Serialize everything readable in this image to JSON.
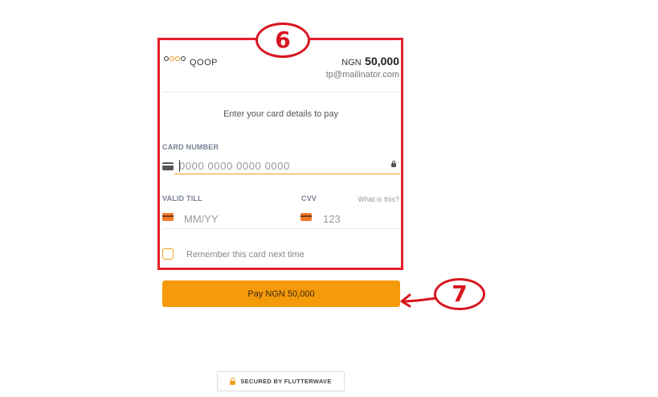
{
  "merchant": {
    "name": "QOOP"
  },
  "payment": {
    "currency": "NGN",
    "amount": "50,000",
    "email": "tp@mailinator.com"
  },
  "form": {
    "instruction": "Enter your card details to pay",
    "card_number_label": "CARD NUMBER",
    "card_number_placeholder": "0000 0000 0000 0000",
    "valid_till_label": "VALID TILL",
    "valid_till_placeholder": "MM/YY",
    "cvv_label": "CVV",
    "cvv_placeholder": "123",
    "cvv_help": "What is this?",
    "remember_label": "Remember this card next time"
  },
  "pay_button": {
    "label": "Pay NGN 50,000"
  },
  "footer": {
    "secured_text": "SECURED BY FLUTTERWAVE"
  },
  "annotations": {
    "a6": "6",
    "a7": "7"
  },
  "colors": {
    "annotation_red": "#e3202a",
    "accent_orange": "#f59a0a",
    "brand_orange": "#f39a20"
  }
}
